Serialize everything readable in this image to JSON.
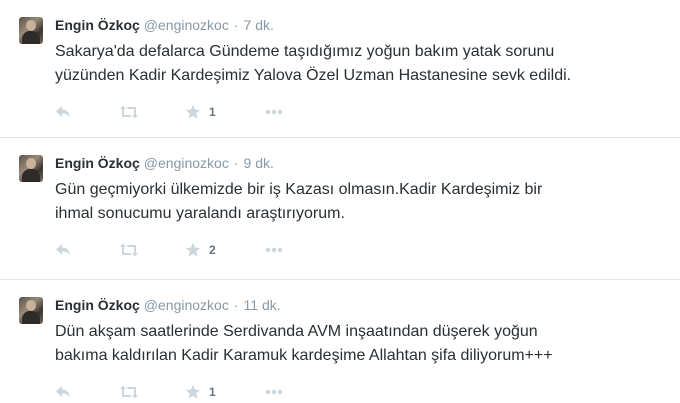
{
  "tweets": [
    {
      "fullname": "Engin Özkoç",
      "username": "@enginozkoc",
      "separator": "·",
      "time": "7 dk.",
      "lines": [
        "Sakarya'da defalarca Gündeme taşıdığımız yoğun bakım yatak sorunu",
        "yüzünden Kadir Kardeşimiz Yalova  Özel Uzman Hastanesine sevk edildi."
      ],
      "favorite_count": "1"
    },
    {
      "fullname": "Engin Özkoç",
      "username": "@enginozkoc",
      "separator": "·",
      "time": "9 dk.",
      "lines": [
        "Gün geçmiyorki ülkemizde bir iş Kazası olmasın.Kadir Kardeşimiz bir",
        "ihmal sonucumu yaralandı araştırıyorum."
      ],
      "favorite_count": "2"
    },
    {
      "fullname": "Engin Özkoç",
      "username": "@enginozkoc",
      "separator": "·",
      "time": "11 dk.",
      "lines": [
        "Dün akşam saatlerinde Serdivanda AVM inşaatından düşerek yoğun",
        "bakıma kaldırılan Kadir Karamuk kardeşime Allahtan şifa diliyorum+++"
      ],
      "favorite_count": "1"
    }
  ],
  "icons": {
    "reply": "reply-icon",
    "retweet": "retweet-icon",
    "favorite": "star-icon",
    "more": "more-icon"
  },
  "colors": {
    "text": "#292f33",
    "muted": "#8899a6",
    "icon": "#ccd6dd",
    "divider": "#e1e8ed"
  }
}
